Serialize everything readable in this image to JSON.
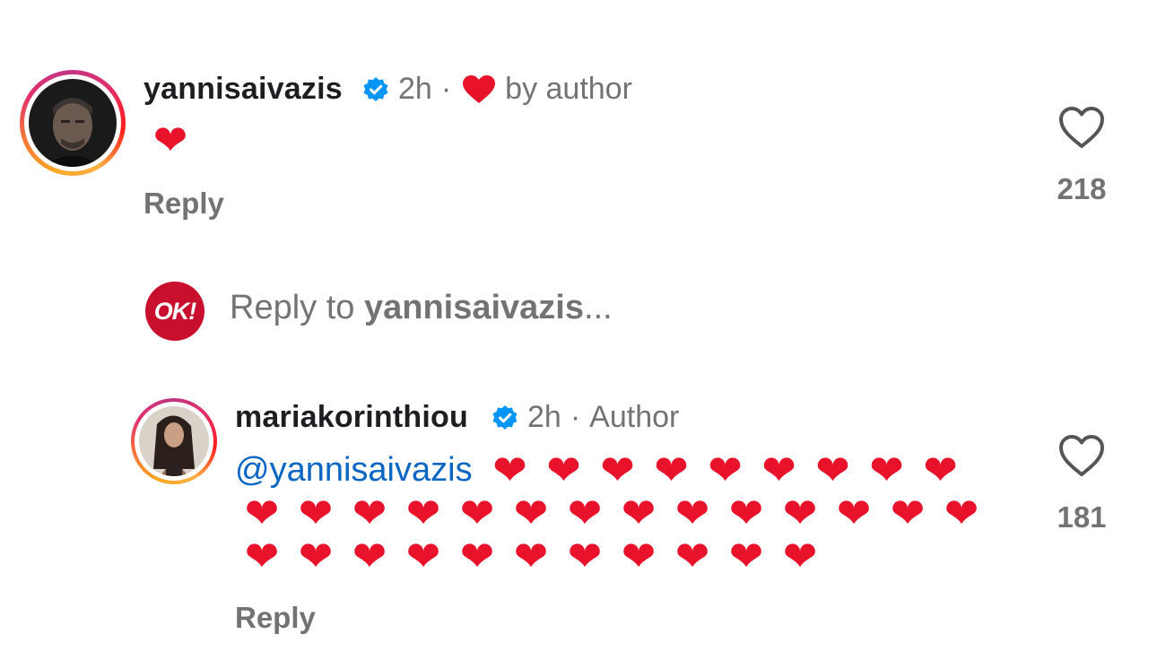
{
  "comments": [
    {
      "username": "yannisaivazis",
      "time": "2h",
      "separator": "·",
      "liked_by_author_label": "by author",
      "text": "❤️",
      "reply_label": "Reply",
      "like_count": "218"
    },
    {
      "username": "mariakorinthiou",
      "time": "2h",
      "separator": "·",
      "author_label": "Author",
      "mention": "@yannisaivazis",
      "hearts_rows": [
        9,
        14,
        11
      ],
      "reply_label": "Reply",
      "like_count": "181"
    }
  ],
  "reply_box": {
    "logo_text": "OK!",
    "prefix": "Reply to",
    "target": "yannisaivazis",
    "suffix": "..."
  },
  "colors": {
    "verified": "#0095f6",
    "heart": "#e8122a",
    "mention": "#0a66c2",
    "muted": "#737373",
    "ok_brand": "#c8102e"
  },
  "icons": [
    "verified-badge-icon",
    "heart-icon",
    "like-outline-icon"
  ]
}
